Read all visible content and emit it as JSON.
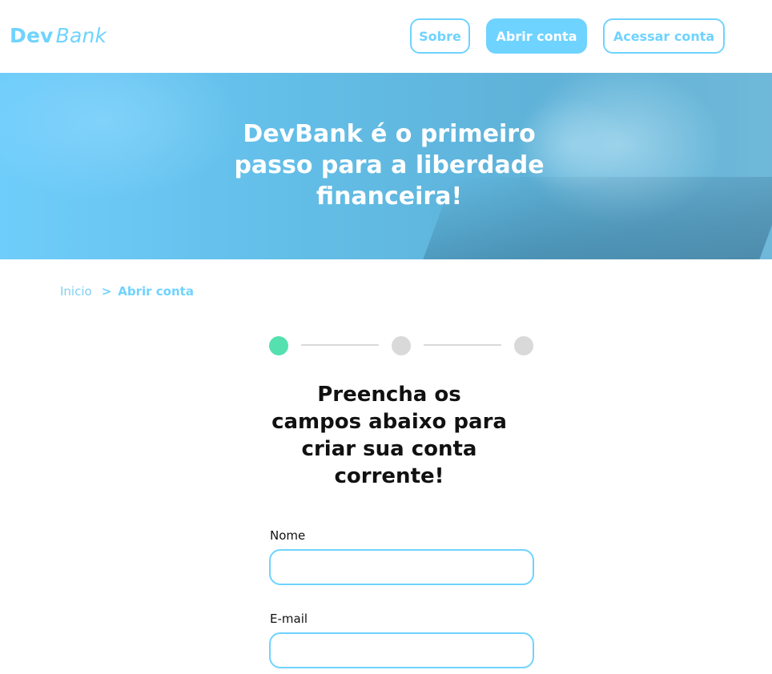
{
  "header": {
    "logo_dev": "Dev",
    "logo_bank": "Bank",
    "nav": {
      "sobre": "Sobre",
      "abrir_conta": "Abrir conta",
      "acessar_conta": "Acessar conta"
    }
  },
  "hero": {
    "title": "DevBank é o primeiro passo para a liberdade financeira!"
  },
  "breadcrumb": {
    "home": "Inicio",
    "separator": ">",
    "current": "Abrir conta"
  },
  "stepper": {
    "total_steps": 3,
    "current_step": 1
  },
  "form": {
    "title": "Preencha os campos abaixo para criar sua conta corrente!",
    "fields": [
      {
        "label": "Nome",
        "value": "",
        "placeholder": ""
      },
      {
        "label": "E-mail",
        "value": "",
        "placeholder": ""
      }
    ]
  },
  "colors": {
    "accent": "#6fd3ff",
    "step_active": "#55e0b0",
    "step_inactive": "#d9d9d9",
    "text": "#111111"
  }
}
